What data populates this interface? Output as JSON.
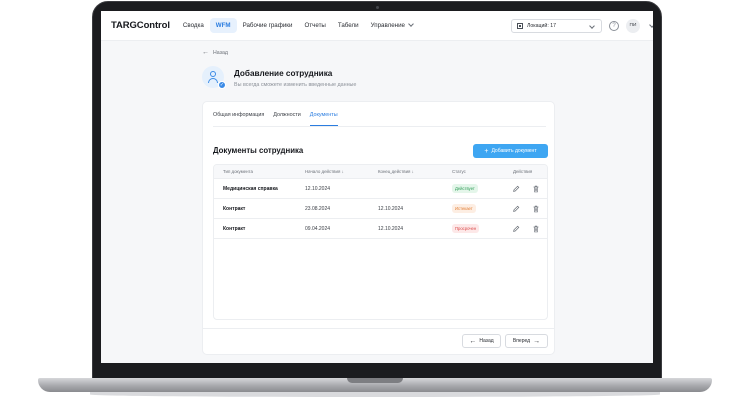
{
  "nav": {
    "logo": "TARGControl",
    "items": [
      "Сводка",
      "WFM",
      "Рабочие графики",
      "Отчеты",
      "Табели",
      "Управление"
    ],
    "active": "WFM",
    "location_select": "Локаций: 17",
    "help": "?",
    "user_initials": "ПИ"
  },
  "header": {
    "back": "Назад",
    "title": "Добавление сотрудника",
    "subtitle": "Вы всегда сможете изменить введенные данные"
  },
  "tabs": [
    "Общая информация",
    "Должности",
    "Документы"
  ],
  "active_tab": "Документы",
  "documents": {
    "title": "Документы сотрудника",
    "add_button": "Добавить документ",
    "columns": [
      "Тип документа",
      "Начало действия ↓",
      "Конец действия ↓",
      "Статус",
      "Действия"
    ],
    "rows": [
      {
        "type": "Медицинская справка",
        "start": "12.10.2024",
        "end": "",
        "status": "Действует",
        "status_color": "green"
      },
      {
        "type": "Контракт",
        "start": "23.08.2024",
        "end": "12.10.2024",
        "status": "Истекает",
        "status_color": "orange"
      },
      {
        "type": "Контракт",
        "start": "09.04.2024",
        "end": "12.10.2024",
        "status": "Просрочен",
        "status_color": "red"
      }
    ]
  },
  "footer": {
    "back_button": "Назад",
    "next_button": "Вперед"
  },
  "colors": {
    "accent": "#2b7de0",
    "button": "#3ea6f2",
    "status_green": "#2e9b56",
    "status_orange": "#e07a2e",
    "status_red": "#d94848"
  }
}
